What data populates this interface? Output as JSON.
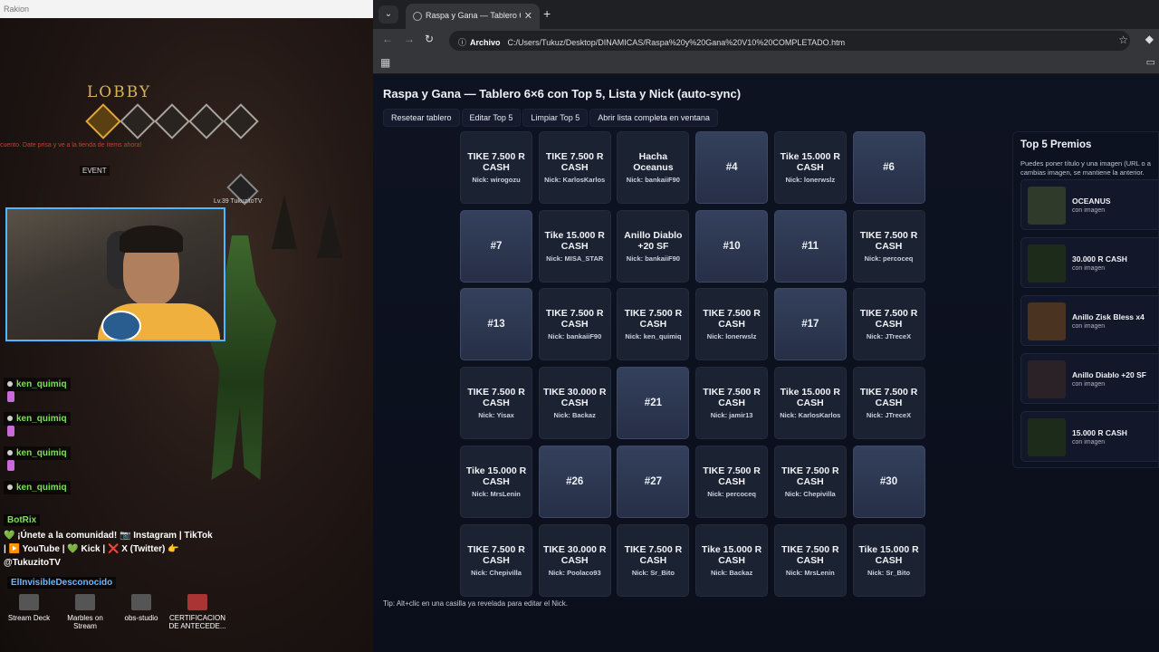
{
  "game": {
    "window_title": "Rakion",
    "lobby_title": "LOBBY",
    "lobby_notice": "cuento. Date prisa y ve a la tienda de ítems ahora!",
    "event_label": "EVENT",
    "player_level": "Lv.39 TukuzitoTV"
  },
  "chat": {
    "messages": [
      {
        "user": "ken_quimiq"
      },
      {
        "user": "ken_quimiq"
      },
      {
        "user": "ken_quimiq"
      },
      {
        "user": "ken_quimiq"
      }
    ],
    "bot_user": "BotRix",
    "bot_message": "💚 ¡Únete a la comunidad! 📷 Instagram | TikTok | ▶️ YouTube | 💚 Kick | ❌ X (Twitter) 👉 @TukuzitoTV",
    "last_user": "ElInvisibleDesconocido"
  },
  "desktop": {
    "icons": [
      "Stream Deck",
      "Marbles on Stream",
      "obs-studio",
      "CERTIFICACION DE ANTECEDE..."
    ]
  },
  "browser": {
    "tab_title": "Raspa y Gana — Tablero 6x6",
    "address_chip": "Archivo",
    "url": "C:/Users/Tukuz/Desktop/DINAMICAS/Raspa%20y%20Gana%20V10%20COMPLETADO.htm"
  },
  "page": {
    "title": "Raspa y Gana — Tablero 6×6 con Top 5, Lista y Nick (auto-sync)",
    "buttons": [
      "Resetear tablero",
      "Editar Top 5",
      "Limpiar Top 5",
      "Abrir lista completa en ventana"
    ],
    "tip": "Tip: Alt+clic en una casilla ya revelada para editar el Nick."
  },
  "board": {
    "cells": [
      {
        "state": "revealed",
        "prize": "TIKE 7.500 R CASH",
        "nick": "Nick: wirogozu"
      },
      {
        "state": "revealed",
        "prize": "TIKE 7.500 R CASH",
        "nick": "Nick: KarlosKarlos"
      },
      {
        "state": "revealed",
        "prize": "Hacha Oceanus",
        "nick": "Nick: bankaiiF90"
      },
      {
        "state": "hidden",
        "label": "#4"
      },
      {
        "state": "revealed",
        "prize": "Tike 15.000 R CASH",
        "nick": "Nick: lonerwslz"
      },
      {
        "state": "hidden",
        "label": "#6"
      },
      {
        "state": "hidden",
        "label": "#7"
      },
      {
        "state": "revealed",
        "prize": "Tike 15.000 R CASH",
        "nick": "Nick: MISA_STAR"
      },
      {
        "state": "revealed",
        "prize": "Anillo Diablo +20 SF",
        "nick": "Nick: bankaiiF90"
      },
      {
        "state": "hidden",
        "label": "#10"
      },
      {
        "state": "hidden",
        "label": "#11"
      },
      {
        "state": "revealed",
        "prize": "TIKE 7.500 R CASH",
        "nick": "Nick: percoceq"
      },
      {
        "state": "hidden",
        "label": "#13"
      },
      {
        "state": "revealed",
        "prize": "TIKE 7.500 R CASH",
        "nick": "Nick: bankaiiF90"
      },
      {
        "state": "revealed",
        "prize": "TIKE 7.500 R CASH",
        "nick": "Nick: ken_quimiq"
      },
      {
        "state": "revealed",
        "prize": "TIKE 7.500 R CASH",
        "nick": "Nick: lonerwslz"
      },
      {
        "state": "hidden",
        "label": "#17"
      },
      {
        "state": "revealed",
        "prize": "TIKE 7.500 R CASH",
        "nick": "Nick: JTreceX"
      },
      {
        "state": "revealed",
        "prize": "TIKE 7.500 R CASH",
        "nick": "Nick: Yisax"
      },
      {
        "state": "revealed",
        "prize": "TIKE 30.000 R CASH",
        "nick": "Nick: Backaz"
      },
      {
        "state": "hidden",
        "label": "#21"
      },
      {
        "state": "revealed",
        "prize": "TIKE 7.500 R CASH",
        "nick": "Nick: jamir13"
      },
      {
        "state": "revealed",
        "prize": "Tike 15.000 R CASH",
        "nick": "Nick: KarlosKarlos"
      },
      {
        "state": "revealed",
        "prize": "TIKE 7.500 R CASH",
        "nick": "Nick: JTreceX"
      },
      {
        "state": "revealed",
        "prize": "Tike 15.000 R CASH",
        "nick": "Nick: MrsLenin"
      },
      {
        "state": "hidden",
        "label": "#26"
      },
      {
        "state": "hidden",
        "label": "#27"
      },
      {
        "state": "revealed",
        "prize": "TIKE 7.500 R CASH",
        "nick": "Nick: percoceq"
      },
      {
        "state": "revealed",
        "prize": "TIKE 7.500 R CASH",
        "nick": "Nick: Chepivilla"
      },
      {
        "state": "hidden",
        "label": "#30"
      },
      {
        "state": "revealed",
        "prize": "TIKE 7.500 R CASH",
        "nick": "Nick: Chepivilla"
      },
      {
        "state": "revealed",
        "prize": "TIKE 30.000 R CASH",
        "nick": "Nick: Poolaco93"
      },
      {
        "state": "revealed",
        "prize": "TIKE 7.500 R CASH",
        "nick": "Nick: Sr_Bito"
      },
      {
        "state": "revealed",
        "prize": "Tike 15.000 R CASH",
        "nick": "Nick: Backaz"
      },
      {
        "state": "revealed",
        "prize": "TIKE 7.500 R CASH",
        "nick": "Nick: MrsLenin"
      },
      {
        "state": "revealed",
        "prize": "Tike 15.000 R CASH",
        "nick": "Nick: Sr_Bito"
      }
    ]
  },
  "top5": {
    "title": "Top 5 Premios",
    "description": "Puedes poner título y una imagen (URL o a cambias imagen, se mantiene la anterior.",
    "items": [
      {
        "name": "OCEANUS",
        "sub": "con imagen",
        "thumb_color": "#2f3a2a"
      },
      {
        "name": "30.000 R CASH",
        "sub": "con imagen",
        "thumb_color": "#1d2b1a"
      },
      {
        "name": "Anillo Zisk Bless x4",
        "sub": "con imagen",
        "thumb_color": "#4a3320"
      },
      {
        "name": "Anillo Diablo +20 SF",
        "sub": "con imagen",
        "thumb_color": "#2a2226"
      },
      {
        "name": "15.000 R CASH",
        "sub": "con imagen",
        "thumb_color": "#1d2b1a"
      }
    ]
  }
}
